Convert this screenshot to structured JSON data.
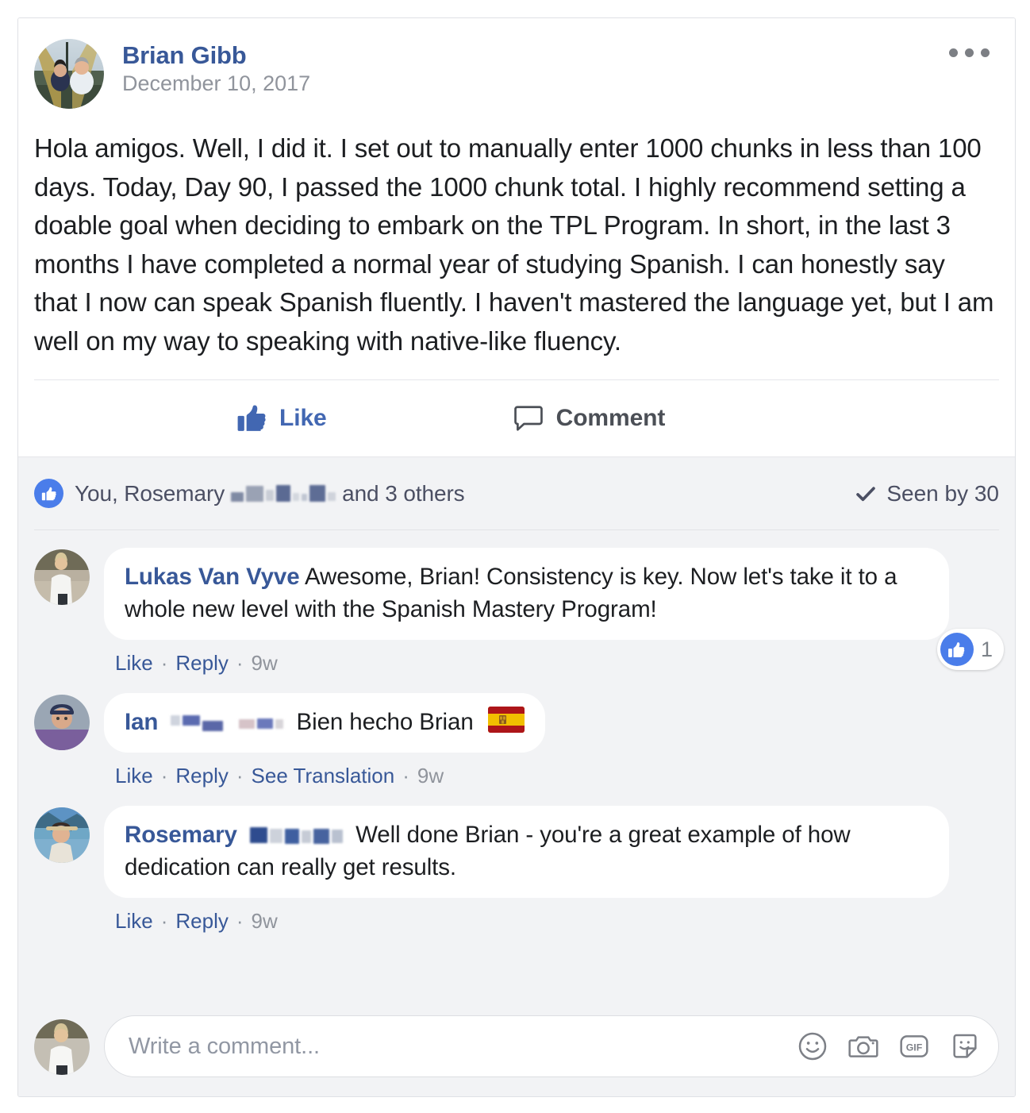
{
  "post": {
    "author": "Brian Gibb",
    "date": "December 10, 2017",
    "body": "Hola amigos. Well, I did it. I set out to manually enter 1000 chunks in less than 100 days. Today, Day 90, I passed the 1000 chunk total. I highly recommend setting a doable goal when deciding to embark on the TPL Program. In short, in the last 3 months I have completed a normal year of studying Spanish. I can honestly say that I now can speak Spanish fluently. I haven't mastered the language yet, but I am well on my way to speaking with native-like fluency.",
    "more_options": "more-options"
  },
  "actions": {
    "like_label": "Like",
    "comment_label": "Comment"
  },
  "reactions": {
    "prefix": "You, Rosemary",
    "suffix": "and 3 others",
    "seen_label": "Seen by 30"
  },
  "comments": [
    {
      "author": "Lukas Van Vyve",
      "text": "Awesome, Brian! Consistency is key. Now let's take it to a whole new level with the Spanish Mastery Program!",
      "like_label": "Like",
      "reply_label": "Reply",
      "time": "9w",
      "like_count": "1",
      "has_translation": false
    },
    {
      "author": "Ian",
      "text": "Bien hecho Brian",
      "like_label": "Like",
      "reply_label": "Reply",
      "translate_label": "See Translation",
      "time": "9w",
      "has_translation": true,
      "emoji": "spain-flag"
    },
    {
      "author": "Rosemary",
      "text": "Well done Brian - you're a great example of how dedication can really get results.",
      "like_label": "Like",
      "reply_label": "Reply",
      "time": "9w",
      "has_translation": false
    }
  ],
  "composer": {
    "placeholder": "Write a comment...",
    "icons": [
      "emoji-icon",
      "camera-icon",
      "gif-icon",
      "sticker-icon"
    ]
  },
  "colors": {
    "link_blue": "#385898",
    "like_blue": "#4267b2",
    "badge_blue": "#4a7dea",
    "comment_bg": "#f2f3f5",
    "text": "#1c1e21",
    "muted": "#90949c"
  }
}
